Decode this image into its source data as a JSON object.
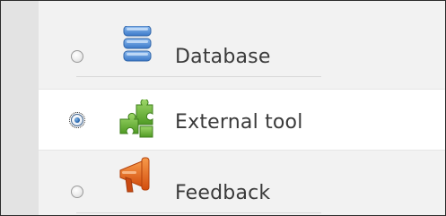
{
  "activity_chooser": {
    "items": [
      {
        "label": "Database",
        "icon": "database-icon",
        "selected": false
      },
      {
        "label": "External tool",
        "icon": "puzzle-piece-icon",
        "selected": true
      },
      {
        "label": "Feedback",
        "icon": "megaphone-icon",
        "selected": false
      }
    ]
  },
  "colors": {
    "list_background": "#f2f2f2",
    "selected_row_background": "#ffffff",
    "left_strip": "#e3e3e3",
    "database_blue": "#4a8ad8",
    "tool_green": "#6db33f",
    "feedback_orange": "#e8611a"
  }
}
